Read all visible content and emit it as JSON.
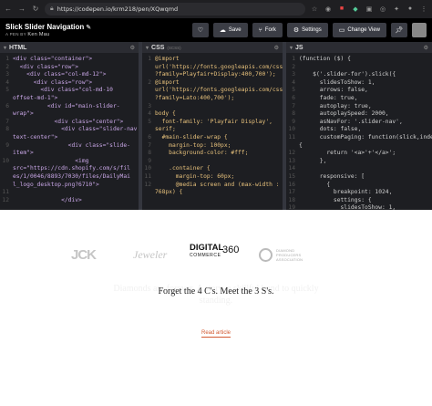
{
  "browser": {
    "url": "https://codepen.io/krm218/pen/XQwqmd",
    "back_icon": "arrow-left-icon",
    "forward_icon": "arrow-right-icon",
    "reload_icon": "reload-icon"
  },
  "pen": {
    "title": "Slick Slider Navigation",
    "by_prefix": "A PEN BY",
    "author": "Ken Mau",
    "buttons": {
      "save": "Save",
      "fork": "Fork",
      "settings": "Settings",
      "change_view": "Change View"
    }
  },
  "editors": {
    "html": {
      "label": "HTML",
      "lines": [
        [
          "1",
          "<div class=\"container\">"
        ],
        [
          "2",
          "  <div class=\"row\">"
        ],
        [
          "3",
          "    <div class=\"col-md-12\">"
        ],
        [
          "4",
          "      <div class=\"row\">"
        ],
        [
          "5",
          "        <div class=\"col-md-10"
        ],
        [
          "",
          "offset-md-1\">"
        ],
        [
          "6",
          "          <div id=\"main-slider-"
        ],
        [
          "",
          "wrap\">"
        ],
        [
          "7",
          "            <div class=\"center\">"
        ],
        [
          "8",
          "              <div class=\"slider-nav"
        ],
        [
          "",
          "text-center\">"
        ],
        [
          "9",
          "                <div class=\"slide-"
        ],
        [
          "",
          "item\">"
        ],
        [
          "10",
          "                  <img"
        ],
        [
          "",
          "src=\"https://cdn.shopify.com/s/fil"
        ],
        [
          "",
          "es/1/0046/8893/7030/files/DailyMai"
        ],
        [
          "",
          "l_logo_desktop.png?6710\">"
        ],
        [
          "11",
          ""
        ],
        [
          "12",
          "              </div>"
        ]
      ]
    },
    "css": {
      "label": "CSS",
      "sub": "(SCSS)",
      "lines": [
        [
          "1",
          "@import"
        ],
        [
          "",
          "url('https://fonts.googleapis.com/css"
        ],
        [
          "",
          "?family=Playfair+Display:400,700');"
        ],
        [
          "2",
          "@import"
        ],
        [
          "",
          "url('https://fonts.googleapis.com/css"
        ],
        [
          "",
          "?family=Lato:400,700');"
        ],
        [
          "3",
          ""
        ],
        [
          "4",
          "body {"
        ],
        [
          "5",
          "  font-family: 'Playfair Display',"
        ],
        [
          "",
          "serif;"
        ],
        [
          "6",
          "  #main-slider-wrap {"
        ],
        [
          "7",
          "    margin-top: 100px;"
        ],
        [
          "8",
          "    background-color: #fff;"
        ],
        [
          "9",
          ""
        ],
        [
          "10",
          "    .container {"
        ],
        [
          "11",
          "      margin-top: 60px;"
        ],
        [
          "12",
          "      @media screen and (max-width :"
        ],
        [
          "",
          "768px) {"
        ]
      ]
    },
    "js": {
      "label": "JS",
      "lines": [
        [
          "1",
          "(function ($) {"
        ],
        [
          "2",
          ""
        ],
        [
          "3",
          "    $('.slider-for').slick({"
        ],
        [
          "4",
          "      slidesToShow: 1,"
        ],
        [
          "5",
          "      arrows: false,"
        ],
        [
          "6",
          "      fade: true,"
        ],
        [
          "7",
          "      autoplay: true,"
        ],
        [
          "8",
          "      autoplaySpeed: 2000,"
        ],
        [
          "9",
          "      asNavFor: '.slider-nav',"
        ],
        [
          "10",
          "      dots: false,"
        ],
        [
          "11",
          "      customPaging: function(slick,index)"
        ],
        [
          "",
          "{"
        ],
        [
          "12",
          "        return '<a>'+'</a>';"
        ],
        [
          "13",
          "      },"
        ],
        [
          "14",
          ""
        ],
        [
          "15",
          "      responsive: ["
        ],
        [
          "16",
          "        {"
        ],
        [
          "17",
          "          breakpoint: 1024,"
        ],
        [
          "18",
          "          settings: {"
        ],
        [
          "19",
          "            slidesToShow: 1,"
        ]
      ]
    }
  },
  "preview": {
    "logos": {
      "jck": "JCK",
      "jeweler": "Jeweler",
      "digital_top": "DIGITAL",
      "digital_bottom": "COMMERCE",
      "digital_number": "360",
      "dia_line1": "DIAMOND",
      "dia_line2": "PRODUCERS",
      "dia_line3": "ASSOCIATION"
    },
    "ghost_text": "Diamonds are forever. A story, a skillful bond to quickly",
    "ghost_text2": "standing.",
    "headline": "Forget the 4 C's. Meet the 3 S's.",
    "read_link": "Read article"
  }
}
